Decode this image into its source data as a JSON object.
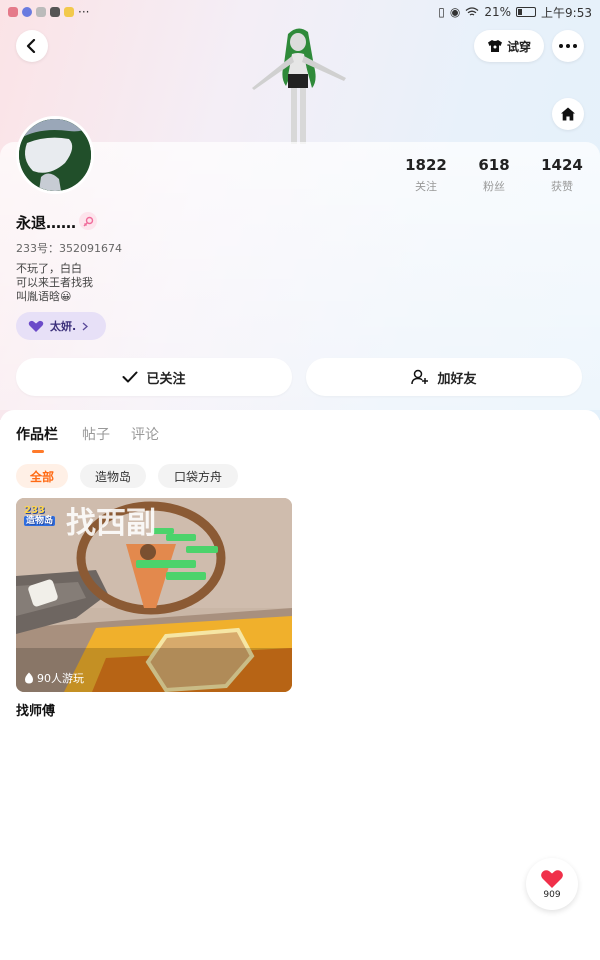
{
  "status_bar": {
    "battery_percent": "21%",
    "time": "上午9:53",
    "more": "···"
  },
  "header": {
    "try_on_label": "试穿"
  },
  "profile": {
    "name": "永退……",
    "uid": "233号：352091674",
    "bio_lines": [
      "不玩了，白白",
      "可以来王者找我",
      "叫胤语晗😀"
    ],
    "tag_label": "太妍.",
    "stats": [
      {
        "value": "1822",
        "label": "关注"
      },
      {
        "value": "618",
        "label": "粉丝"
      },
      {
        "value": "1424",
        "label": "获赞"
      }
    ],
    "follow_label": "已关注",
    "add_friend_label": "加好友"
  },
  "tabs": [
    {
      "label": "作品栏",
      "active": true
    },
    {
      "label": "帖子",
      "active": false
    },
    {
      "label": "评论",
      "active": false
    }
  ],
  "filters": [
    {
      "label": "全部",
      "active": true
    },
    {
      "label": "造物岛",
      "active": false
    },
    {
      "label": "口袋方舟",
      "active": false
    }
  ],
  "works": [
    {
      "overlay_title": "找西副",
      "logo_text": "233",
      "logo_sub": "造物岛",
      "plays": "90人游玩",
      "title": "找师傅"
    }
  ],
  "like_button": {
    "count": "909"
  },
  "colors": {
    "accent": "#ff6a14",
    "tag_bg": "#e7e0f7",
    "heart": "#f0304a"
  }
}
